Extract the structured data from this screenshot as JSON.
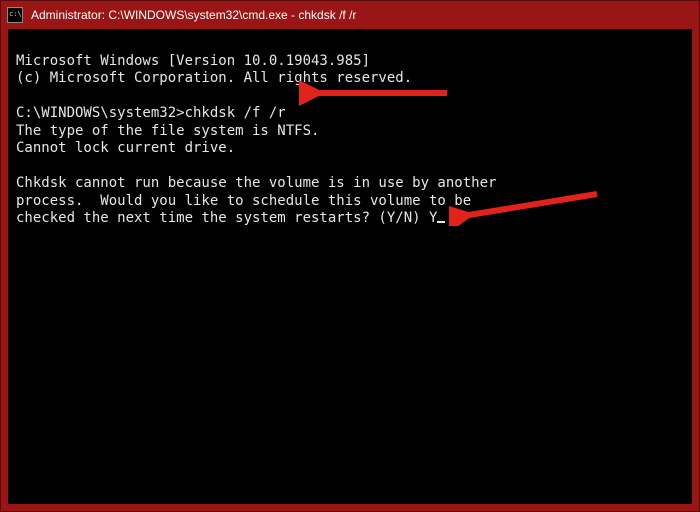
{
  "titlebar": {
    "title": "Administrator: C:\\WINDOWS\\system32\\cmd.exe - chkdsk  /f /r"
  },
  "console": {
    "line_version": "Microsoft Windows [Version 10.0.19043.985]",
    "line_copyright": "(c) Microsoft Corporation. All rights reserved.",
    "prompt": "C:\\WINDOWS\\system32>",
    "command": "chkdsk /f /r",
    "line_fs": "The type of the file system is NTFS.",
    "line_lock": "Cannot lock current drive.",
    "line_busy1": "Chkdsk cannot run because the volume is in use by another",
    "line_busy2": "process.  Would you like to schedule this volume to be",
    "line_busy3_q": "checked the next time the system restarts? (Y/N) ",
    "user_answer": "Y"
  },
  "colors": {
    "titlebar": "#9a1515",
    "terminal_bg": "#000000",
    "terminal_fg": "#e6e6e6",
    "arrow": "#e2231a"
  }
}
